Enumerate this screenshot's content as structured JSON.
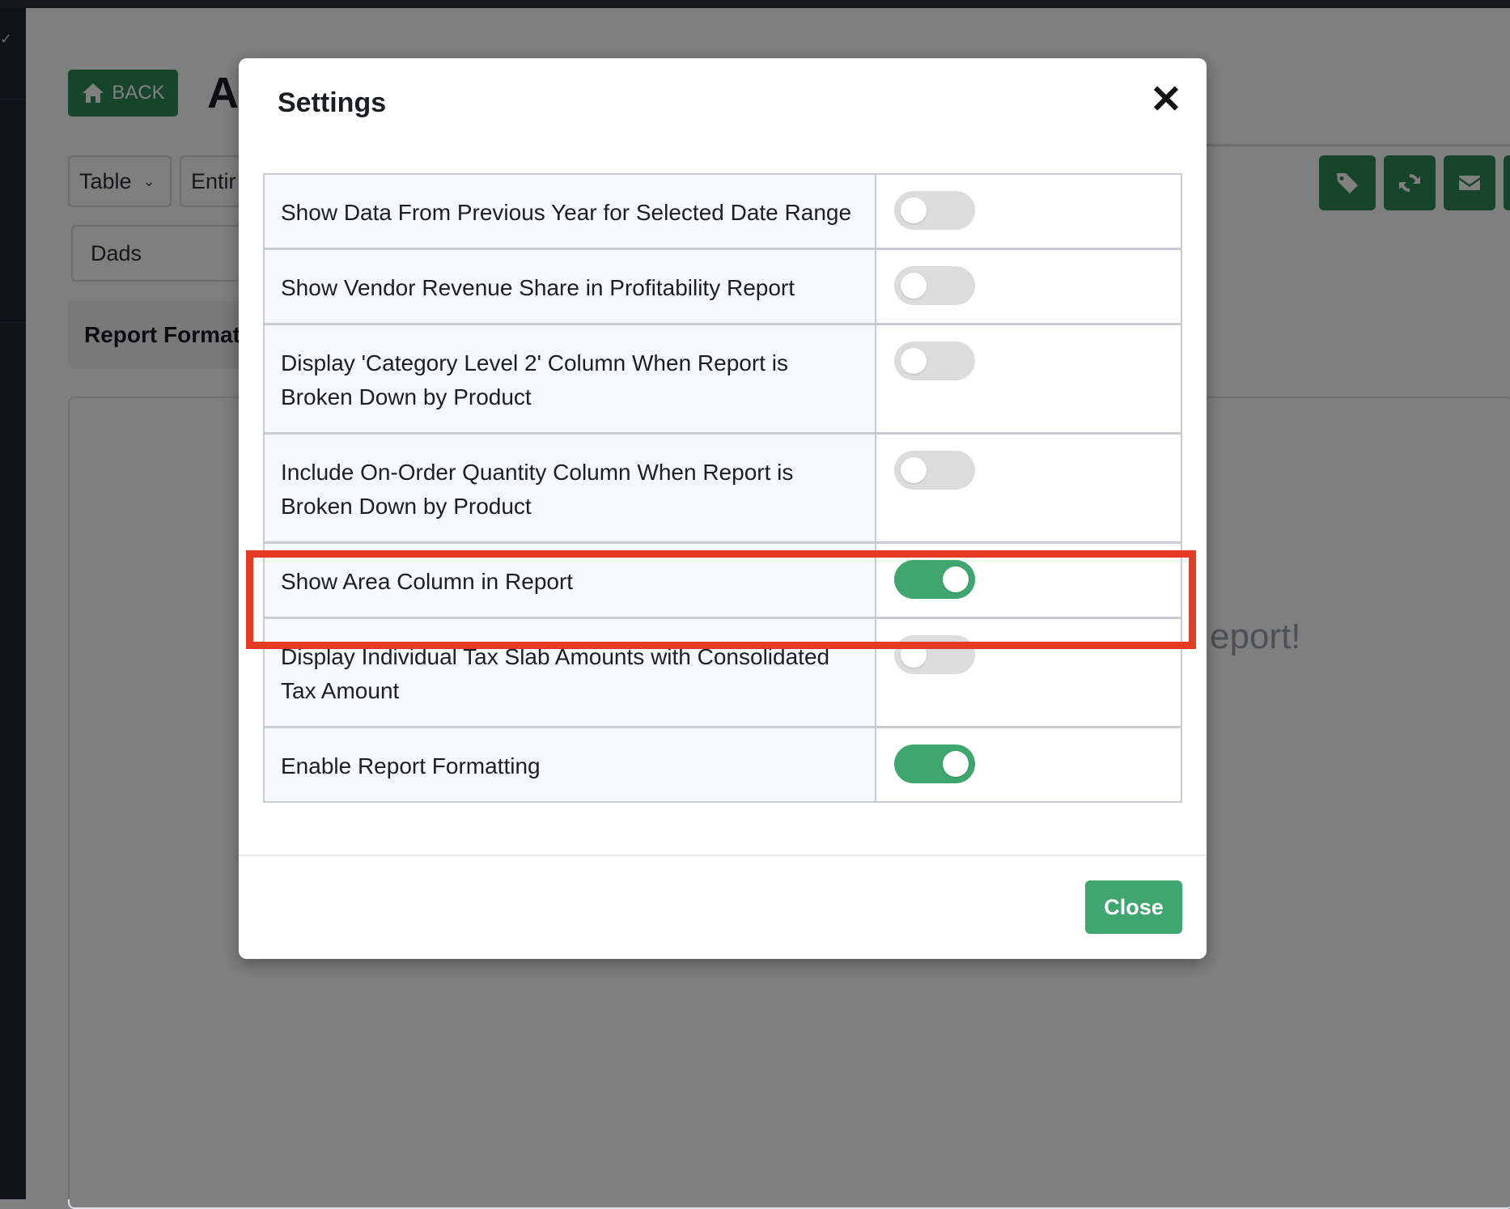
{
  "background": {
    "back_label": "BACK",
    "page_title": "A",
    "selects": {
      "view": "Table",
      "range": "Entir",
      "store": "Dads"
    },
    "tab_label": "Report Format",
    "empty_message": "eport!"
  },
  "modal": {
    "title": "Settings",
    "close_icon": "✕",
    "close_button": "Close",
    "settings": [
      {
        "label": "Show Data From Previous Year for Selected Date Range",
        "enabled": false
      },
      {
        "label": "Show Vendor Revenue Share in Profitability Report",
        "enabled": false
      },
      {
        "label": "Display 'Category Level 2' Column When Report is Broken Down by Product",
        "enabled": false
      },
      {
        "label": "Include On-Order Quantity Column When Report is Broken Down by Product",
        "enabled": false
      },
      {
        "label": "Show Area Column in Report",
        "enabled": true,
        "highlighted": true
      },
      {
        "label": "Display Individual Tax Slab Amounts with Consolidated Tax Amount",
        "enabled": false
      },
      {
        "label": "Enable Report Formatting",
        "enabled": true
      }
    ]
  },
  "colors": {
    "primary_green": "#2e8b57",
    "toggle_on": "#3ea66e",
    "highlight_red": "#e53a24"
  }
}
